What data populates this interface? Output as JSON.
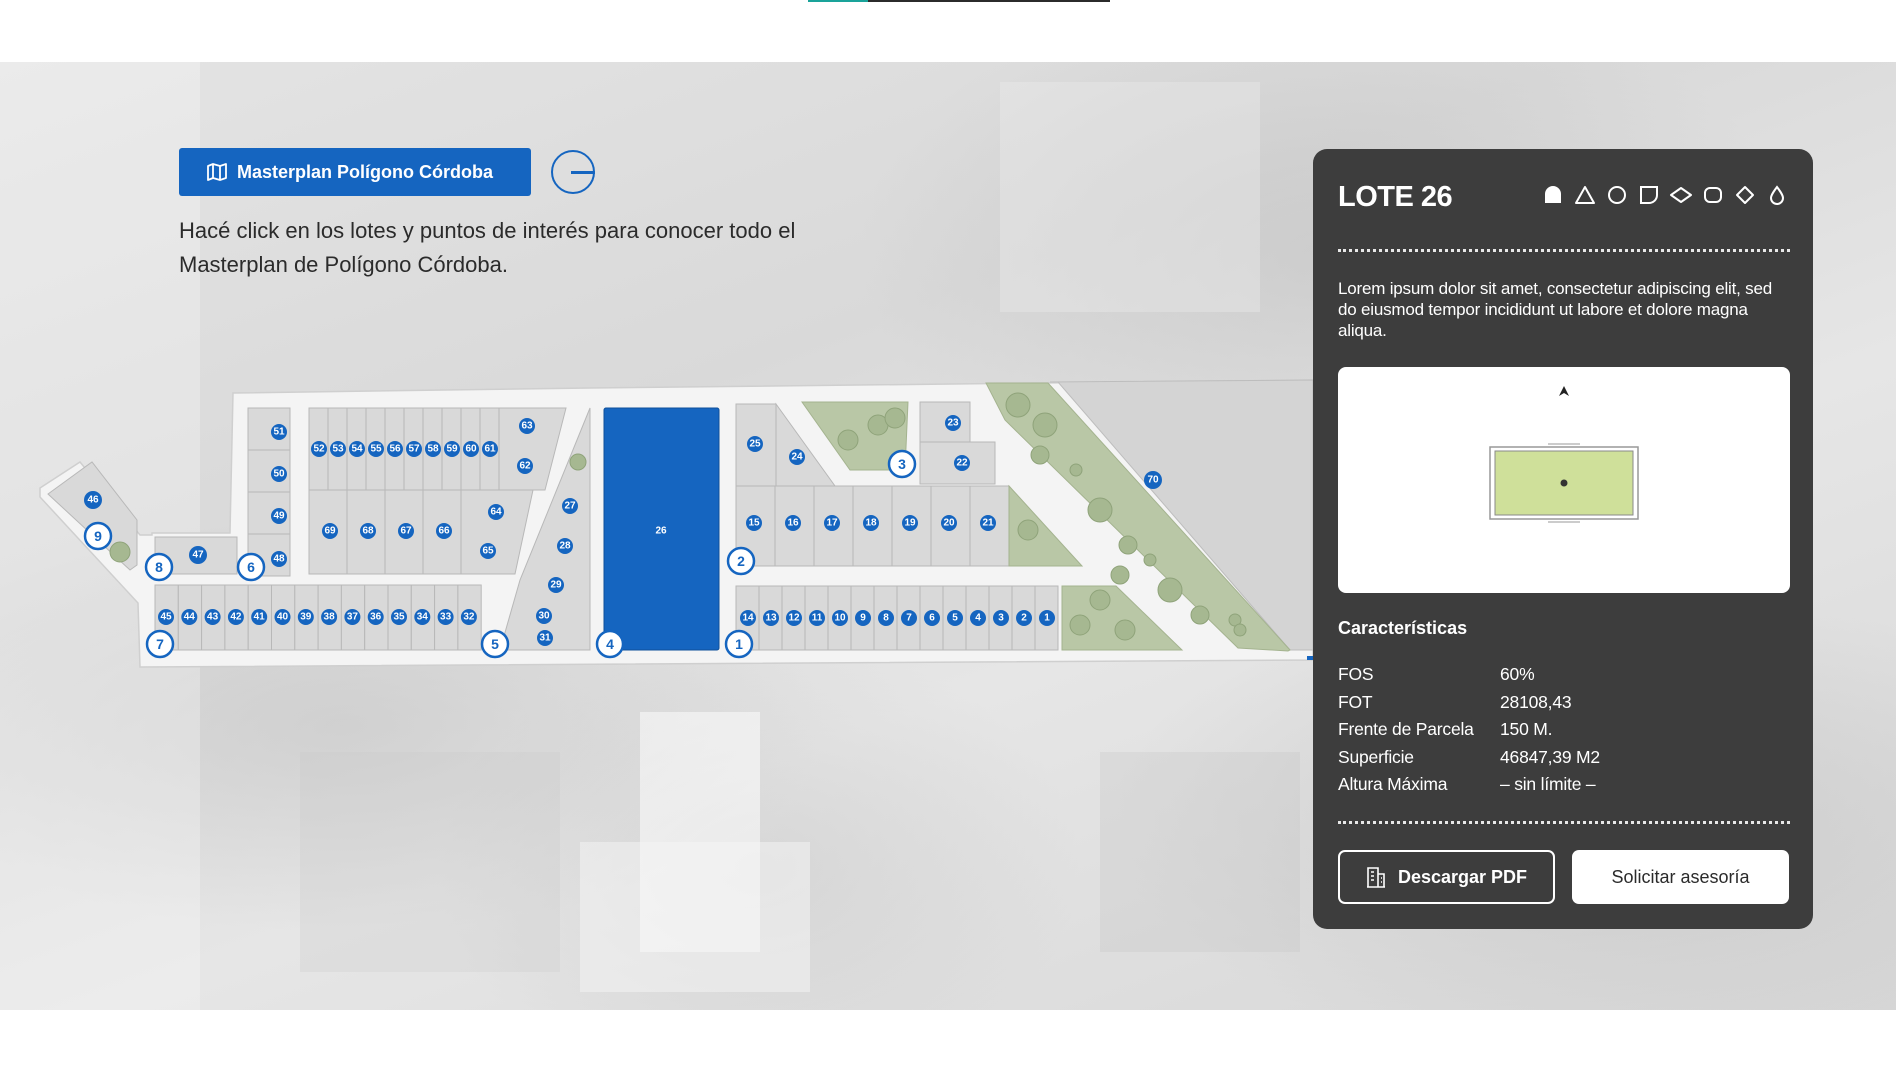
{
  "hero": {
    "masterplan_button_label": "Masterplan Polígono Córdoba",
    "intro_text": "Hacé click en los lotes y puntos de interés para conocer todo el Masterplan de Polígono Córdoba."
  },
  "plan": {
    "lot_26_label": "26",
    "lot_70_label": "70",
    "lot_47_label": "47",
    "lot_46_label": "46",
    "left_block_lots": [
      "51",
      "50",
      "49",
      "48"
    ],
    "top_row_lots": [
      "52",
      "53",
      "54",
      "55",
      "56",
      "57",
      "58",
      "59",
      "60",
      "61"
    ],
    "mid_row_lots": [
      "69",
      "68",
      "67",
      "66"
    ],
    "right_column_lots": [
      "63",
      "62",
      "64",
      "65"
    ],
    "small_column_lots": [
      "27",
      "28",
      "29",
      "30",
      "31"
    ],
    "bottom_left_row_lots": [
      "45",
      "44",
      "43",
      "42",
      "41",
      "40",
      "39",
      "38",
      "37",
      "36",
      "35",
      "34",
      "33",
      "32"
    ],
    "east_upper_lots": [
      "25",
      "24",
      "23",
      "22"
    ],
    "east_mid_row_lots": [
      "15",
      "16",
      "17",
      "18",
      "19",
      "20",
      "21"
    ],
    "bottom_right_row_lots": [
      "14",
      "13",
      "12",
      "11",
      "10",
      "9",
      "8",
      "7",
      "6",
      "5",
      "4",
      "3",
      "2",
      "1"
    ],
    "points_of_interest": [
      "1",
      "2",
      "3",
      "4",
      "5",
      "6",
      "7",
      "8",
      "9"
    ],
    "colors": {
      "selected_lot": "#1565c0",
      "lot": "#d9d9d9",
      "green_area": "#b9c7a6",
      "poi": "#1565c0"
    }
  },
  "panel": {
    "title": "LOTE 26",
    "shape_icons": [
      "shape-rounded-icon",
      "triangle-icon",
      "circle-icon",
      "shape-cut-corner-icon",
      "diamond-wide-icon",
      "rounded-square-icon",
      "diamond-icon",
      "drop-icon"
    ],
    "description": "Lorem ipsum dolor sit amet, consectetur adipiscing elit, sed do eiusmod tempor incididunt ut labore et dolore magna aliqua.",
    "features_heading": "Características",
    "features": [
      {
        "label": "FOS",
        "value": "60%"
      },
      {
        "label": "FOT",
        "value": "28108,43"
      },
      {
        "label": "Frente de Parcela",
        "value": "150 M."
      },
      {
        "label": "Superficie",
        "value": "46847,39 M2"
      },
      {
        "label": "Altura Máxima",
        "value": "– sin límite –"
      }
    ],
    "download_label": "Descargar PDF",
    "advice_label": "Solicitar asesoría",
    "colors": {
      "background": "#3d3d3d",
      "preview_lot_fill": "#cfe09a"
    }
  }
}
